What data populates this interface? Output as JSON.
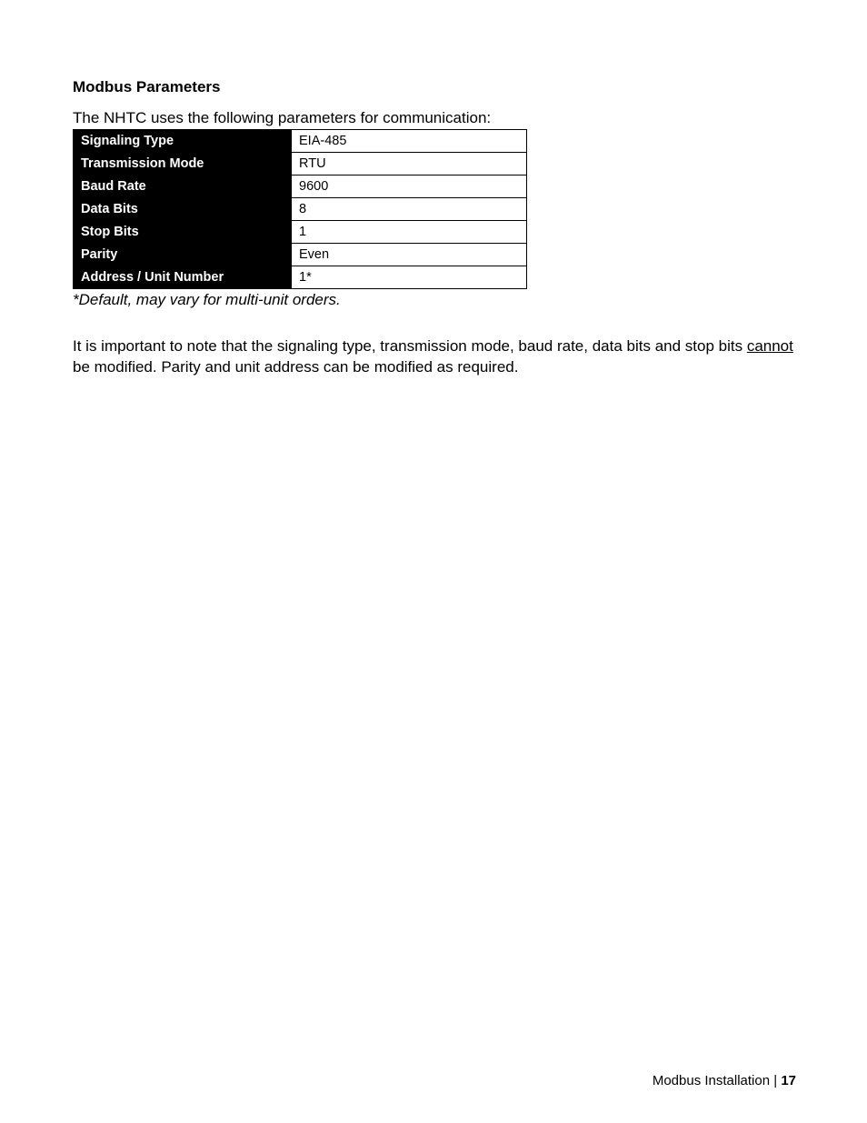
{
  "header": {
    "title": "Modbus Parameters",
    "intro": "The NHTC uses the following parameters for communication:"
  },
  "table": {
    "rows": [
      {
        "label": "Signaling Type",
        "value": "EIA-485"
      },
      {
        "label": "Transmission Mode",
        "value": "RTU"
      },
      {
        "label": "Baud Rate",
        "value": "9600"
      },
      {
        "label": "Data Bits",
        "value": "8"
      },
      {
        "label": "Stop Bits",
        "value": "1"
      },
      {
        "label": "Parity",
        "value": "Even"
      },
      {
        "label": "Address / Unit Number",
        "value": "1*"
      }
    ],
    "note": "*Default, may vary for multi-unit orders."
  },
  "body": {
    "para_pre": "It is important to note that the signaling type, transmission mode, baud rate, data bits and stop bits ",
    "para_underline": "cannot",
    "para_post": " be modified.  Parity and unit address can be modified as required."
  },
  "footer": {
    "section": "Modbus Installation",
    "separator": " | ",
    "page": "17"
  }
}
